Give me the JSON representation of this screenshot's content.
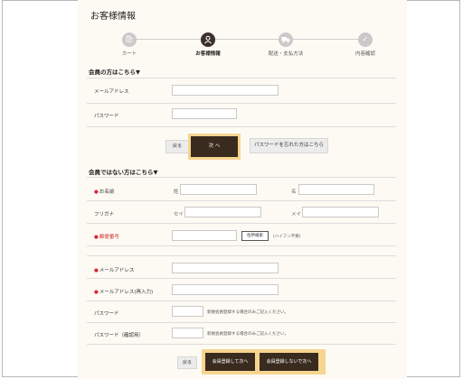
{
  "page": {
    "title": "お客様情報"
  },
  "steps": [
    {
      "label": "カート",
      "icon": "bag-icon"
    },
    {
      "label": "お客様情報",
      "icon": "user-icon"
    },
    {
      "label": "配送・支払方法",
      "icon": "truck-icon"
    },
    {
      "label": "内容確認",
      "icon": "check-icon"
    }
  ],
  "member": {
    "heading": "会員の方はこちら▼",
    "email_label": "メールアドレス",
    "password_label": "パスワード",
    "back_label": "戻る",
    "next_label": "次 へ",
    "forgot_label": "パスワードを忘れた方はこちら"
  },
  "guest": {
    "heading": "会員ではない方はこちら▼",
    "name_label": "お名前",
    "last_name_sub": "姓",
    "first_name_sub": "名",
    "kana_label": "フリガナ",
    "last_kana_sub": "セイ",
    "first_kana_sub": "メイ",
    "postal_label": "郵便番号",
    "address_search_label": "住所検索",
    "postal_hint": "(ハイフン不要)",
    "email_label": "メールアドレス",
    "email_confirm_label": "メールアドレス(再入力)",
    "password_label": "パスワード",
    "password_note": "新規会員登録する場合のみご記入ください。",
    "password_confirm_label": "パスワード（確認用）",
    "password_confirm_note": "新規会員登録する場合のみご記入ください。",
    "back_label": "戻る",
    "register_next_label": "会員登録して次へ",
    "no_register_next_label": "会員登録しないで次へ",
    "required_mark": "●"
  }
}
